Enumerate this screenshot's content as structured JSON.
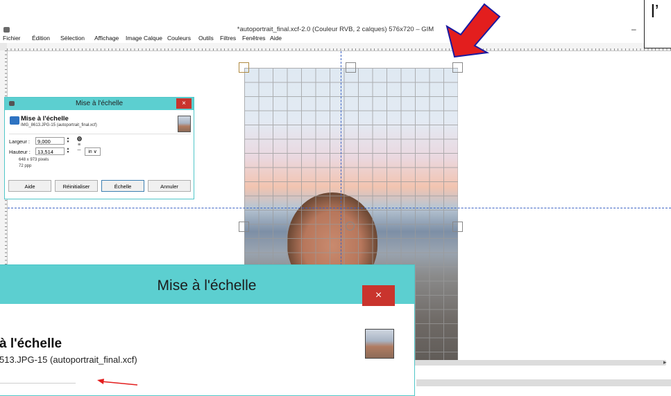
{
  "window": {
    "title": "*autoportrait_final.xcf-2.0 (Couleur RVB, 2 calques) 576x720 – GIM",
    "minimize": "–"
  },
  "menu": [
    "Fichier",
    "Édition",
    "Sélection",
    "Affichage",
    "Image",
    "Calque",
    "Couleurs",
    "Outils",
    "Filtres",
    "Fenêtres",
    "Aide"
  ],
  "corner_box_text": "l’",
  "dialog": {
    "title": "Mise à l'échelle",
    "close": "×",
    "heading": "Mise à l'échelle",
    "subheading": "IMG_8613.JPG-15 (autoportrait_final.xcf)",
    "width_label": "Largeur :",
    "width_value": "9,000",
    "height_label": "Hauteur :",
    "height_value": "13,514",
    "unit": "in ∨",
    "pixels_info": "648 x 973 pixels",
    "resolution_info": "72 ppp",
    "buttons": {
      "help": "Aide",
      "reset": "Réinitialiser",
      "scale": "Échelle",
      "cancel": "Annuler"
    }
  },
  "zoom": {
    "title": "Mise à l'échelle",
    "close": "×",
    "heading": "à l'échelle",
    "subheading": "513.JPG-15 (autoportrait_final.xcf)"
  },
  "colors": {
    "dialog_title_bg": "#5ccfd0",
    "close_bg": "#c9342d",
    "guide": "#3a62c4",
    "arrow": "#e31e1e"
  }
}
